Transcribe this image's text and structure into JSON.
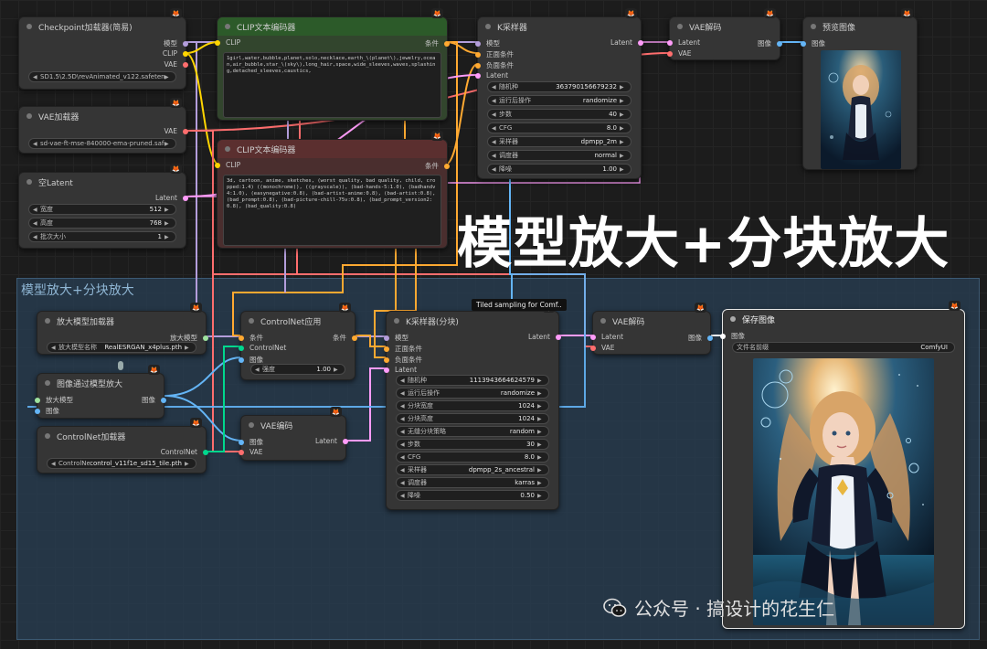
{
  "nodes": {
    "checkpoint": {
      "title": "Checkpoint加载器(简易)",
      "outputs": [
        "模型",
        "CLIP",
        "VAE"
      ],
      "value": "SD1.5\\2.5D\\revAnimated_v122.safetensors"
    },
    "vae_loader": {
      "title": "VAE加载器",
      "outputs": [
        "VAE"
      ],
      "value": "sd-vae-ft-mse-840000-ema-pruned.safetensors"
    },
    "empty_latent": {
      "title": "空Latent",
      "outputs": [
        "Latent"
      ],
      "widgets": [
        {
          "label": "宽度",
          "value": "512"
        },
        {
          "label": "高度",
          "value": "768"
        },
        {
          "label": "批次大小",
          "value": "1"
        }
      ]
    },
    "clip_pos": {
      "title": "CLIP文本编码器",
      "input": "CLIP",
      "output": "条件",
      "text": "1girl,water,bubble,planet,solo,necklace,earth_\\(planet\\),jewelry,ocean,air_bubble,star_\\(sky\\),long_hair,space,wide_sleeves,waves,splashing,detached_sleeves,caustics,"
    },
    "clip_neg": {
      "title": "CLIP文本编码器",
      "input": "CLIP",
      "output": "条件",
      "text": "3d, cartoon, anime, sketches, (worst quality, bad quality, child, cropped:1.4) ((monochrome)), ((grayscale)), (bad-hands-5:1.0), (badhandv4:1.0), (easynegative:0.8), (bad-artist-anime:0.8), (bad-artist:0.8), (bad_prompt:0.8), (bad-picture-chill-75v:0.8), (bad_prompt_version2:0.8), (bad_quality:0.8)"
    },
    "ksampler": {
      "title": "K采样器",
      "inputs": [
        "模型",
        "正面条件",
        "负面条件",
        "Latent"
      ],
      "output": "Latent",
      "widgets": [
        {
          "label": "随机种",
          "value": "363790156679232"
        },
        {
          "label": "运行后操作",
          "value": "randomize"
        },
        {
          "label": "步数",
          "value": "40"
        },
        {
          "label": "CFG",
          "value": "8.0"
        },
        {
          "label": "采样器",
          "value": "dpmpp_2m"
        },
        {
          "label": "调度器",
          "value": "normal"
        },
        {
          "label": "降噪",
          "value": "1.00"
        }
      ]
    },
    "vae_decode1": {
      "title": "VAE解码",
      "inputs": [
        "Latent",
        "VAE"
      ],
      "output": "图像"
    },
    "preview": {
      "title": "预览图像",
      "input": "图像"
    },
    "upscale_loader": {
      "title": "放大模型加载器",
      "output": "放大模型",
      "widget": {
        "label": "放大模型名称",
        "value": "RealESRGAN_x4plus.pth"
      }
    },
    "upscale_by_model": {
      "title": "图像通过模型放大",
      "inputs": [
        "放大模型",
        "图像"
      ],
      "output": "图像"
    },
    "controlnet_loader": {
      "title": "ControlNet加载器",
      "output": "ControlNet",
      "widget": {
        "label": "ControlNet名称",
        "value": "control_v11f1e_sd15_tile.pth"
      }
    },
    "controlnet_apply": {
      "title": "ControlNet应用",
      "inputs": [
        "条件",
        "ControlNet",
        "图像"
      ],
      "output": "条件",
      "widget": {
        "label": "强度",
        "value": "1.00"
      }
    },
    "vae_encode": {
      "title": "VAE编码",
      "inputs": [
        "图像",
        "VAE"
      ],
      "output": "Latent"
    },
    "tiled_ksampler": {
      "title": "K采样器(分块)",
      "tooltip": "Tiled sampling for Comf..",
      "inputs": [
        "模型",
        "正面条件",
        "负面条件",
        "Latent"
      ],
      "output": "Latent",
      "widgets": [
        {
          "label": "随机种",
          "value": "1113943664624579"
        },
        {
          "label": "运行后操作",
          "value": "randomize"
        },
        {
          "label": "分块宽度",
          "value": "1024"
        },
        {
          "label": "分块高度",
          "value": "1024"
        },
        {
          "label": "无缝分块策略",
          "value": "random"
        },
        {
          "label": "步数",
          "value": "30"
        },
        {
          "label": "CFG",
          "value": "8.0"
        },
        {
          "label": "采样器",
          "value": "dpmpp_2s_ancestral"
        },
        {
          "label": "调度器",
          "value": "karras"
        },
        {
          "label": "降噪",
          "value": "0.50"
        }
      ]
    },
    "vae_decode2": {
      "title": "VAE解码",
      "inputs": [
        "Latent",
        "VAE"
      ],
      "output": "图像"
    },
    "save_image": {
      "title": "保存图像",
      "input": "图像",
      "widget": {
        "label": "文件名前缀",
        "value": "ComfyUI"
      }
    }
  },
  "group": {
    "title": "模型放大+分块放大"
  },
  "overlay": {
    "title": "模型放大+分块放大",
    "watermark": "公众号 · 搞设计的花生仁"
  },
  "badge_icon": "fox-icon",
  "colors": {
    "model": "#b39ddb",
    "clip": "#ffd500",
    "vae": "#ff6e6e",
    "conditioning": "#ffa931",
    "latent": "#ff9cf9",
    "image": "#64b5f6",
    "upscale_model": "#9ee29e",
    "controlnet": "#00d78d"
  }
}
